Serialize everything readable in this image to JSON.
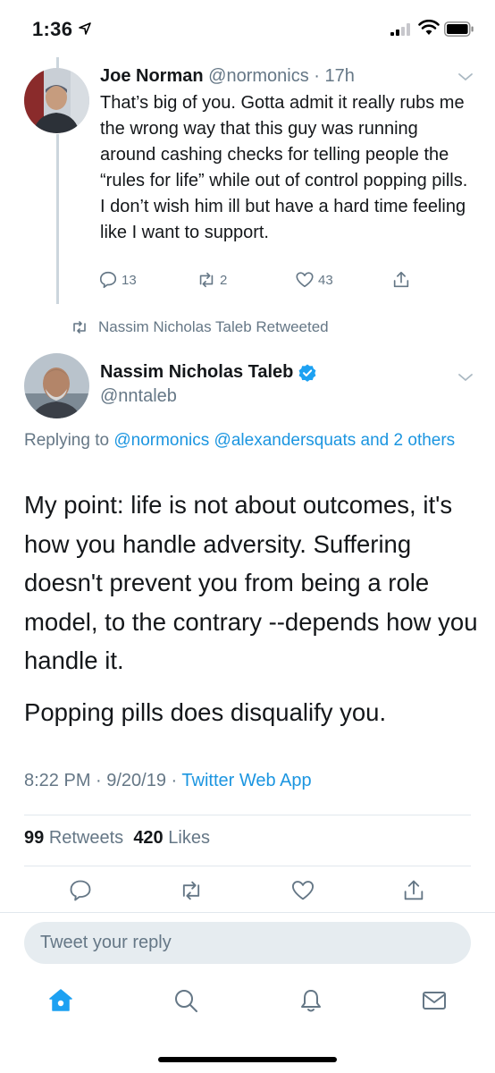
{
  "status_bar": {
    "time": "1:36"
  },
  "reply_tweet": {
    "name": "Joe Norman",
    "handle": "@normonics",
    "time": "17h",
    "text": "That’s big of you. Gotta admit it really rubs me the wrong way that this guy was running around cashing checks for telling people the “rules for life” while out of control popping pills. I don’t wish him ill but have a hard time feeling like I want to support.",
    "reply_count": "13",
    "retweet_count": "2",
    "like_count": "43"
  },
  "retweeted_by": "Nassim Nicholas Taleb Retweeted",
  "main_tweet": {
    "name": "Nassim Nicholas Taleb",
    "handle": "@nntaleb",
    "replying_prefix": "Replying to",
    "replying_links": "@normonics @alexandersquats and 2 others",
    "text": "My point: life is not about outcomes, it's how you handle adversity. Suffering doesn't prevent you from being a role model, to the contrary --depends how you handle it.",
    "text2": "Popping pills does disqualify you.",
    "time": "8:22 PM · 9/20/19 ·",
    "app": "Twitter Web App",
    "retweets_count": "99",
    "retweets_label": "Retweets",
    "likes_count": "420",
    "likes_label": "Likes"
  },
  "reply_box": {
    "placeholder": "Tweet your reply"
  },
  "colors": {
    "accent": "#1da1f2",
    "link": "#1b95e0",
    "muted": "#657786"
  },
  "icons": {
    "tabbar": [
      "home-icon",
      "search-icon",
      "notifications-icon",
      "messages-icon"
    ]
  }
}
